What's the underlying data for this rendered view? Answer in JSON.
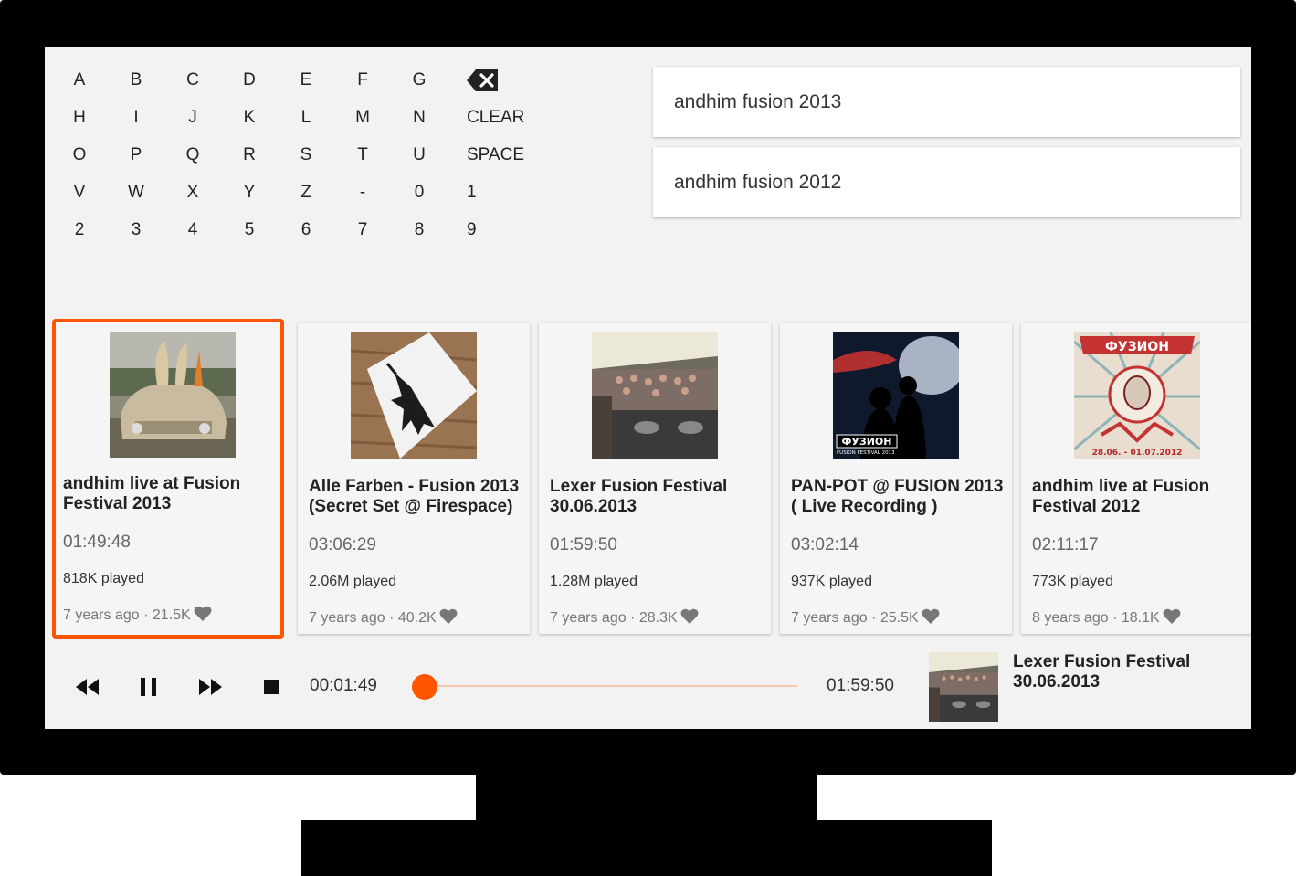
{
  "keyboard": {
    "rows": [
      [
        "A",
        "B",
        "C",
        "D",
        "E",
        "F",
        "G"
      ],
      [
        "H",
        "I",
        "J",
        "K",
        "L",
        "M",
        "N",
        "CLEAR"
      ],
      [
        "O",
        "P",
        "Q",
        "R",
        "S",
        "T",
        "U",
        "SPACE"
      ],
      [
        "V",
        "W",
        "X",
        "Y",
        "Z",
        "-",
        "0",
        "1"
      ],
      [
        "2",
        "3",
        "4",
        "5",
        "6",
        "7",
        "8",
        "9"
      ]
    ],
    "backspace_icon": "backspace-icon"
  },
  "suggestions": [
    "andhim fusion 2013",
    "andhim fusion 2012"
  ],
  "cards": [
    {
      "title": "andhim live at Fusion Festival 2013",
      "duration": "01:49:48",
      "plays": "818K played",
      "age": "7 years ago",
      "likes": "21.5K",
      "selected": true
    },
    {
      "title": "Alle Farben - Fusion 2013 (Secret Set @ Firespace)",
      "duration": "03:06:29",
      "plays": "2.06M played",
      "age": "7 years ago",
      "likes": "40.2K",
      "selected": false
    },
    {
      "title": "Lexer Fusion Festival 30.06.2013",
      "duration": "01:59:50",
      "plays": "1.28M played",
      "age": "7 years ago",
      "likes": "28.3K",
      "selected": false
    },
    {
      "title": "PAN-POT @ FUSION 2013 ( Live Recording )",
      "duration": "03:02:14",
      "plays": "937K played",
      "age": "7 years ago",
      "likes": "25.5K",
      "selected": false
    },
    {
      "title": "andhim live at Fusion Festival 2012",
      "duration": "02:11:17",
      "plays": "773K played",
      "age": "8 years ago",
      "likes": "18.1K",
      "selected": false
    }
  ],
  "artwork_text": {
    "card4_logo": "ФУЗИОН",
    "card4_sub": "FUSION FESTIVAL 2013",
    "card5_logo": "ФУЗИОН",
    "card5_dates": "28.06. - 01.07.2012"
  },
  "meta_separator": "·",
  "player": {
    "elapsed": "00:01:49",
    "total": "01:59:50",
    "progress_fraction": 0.015,
    "now_playing_title": "Lexer Fusion Festival 30.06.2013"
  },
  "colors": {
    "accent": "#ff5500",
    "track": "#f8c9ad",
    "frame": "#000000",
    "screen": "#f2f2f2"
  }
}
